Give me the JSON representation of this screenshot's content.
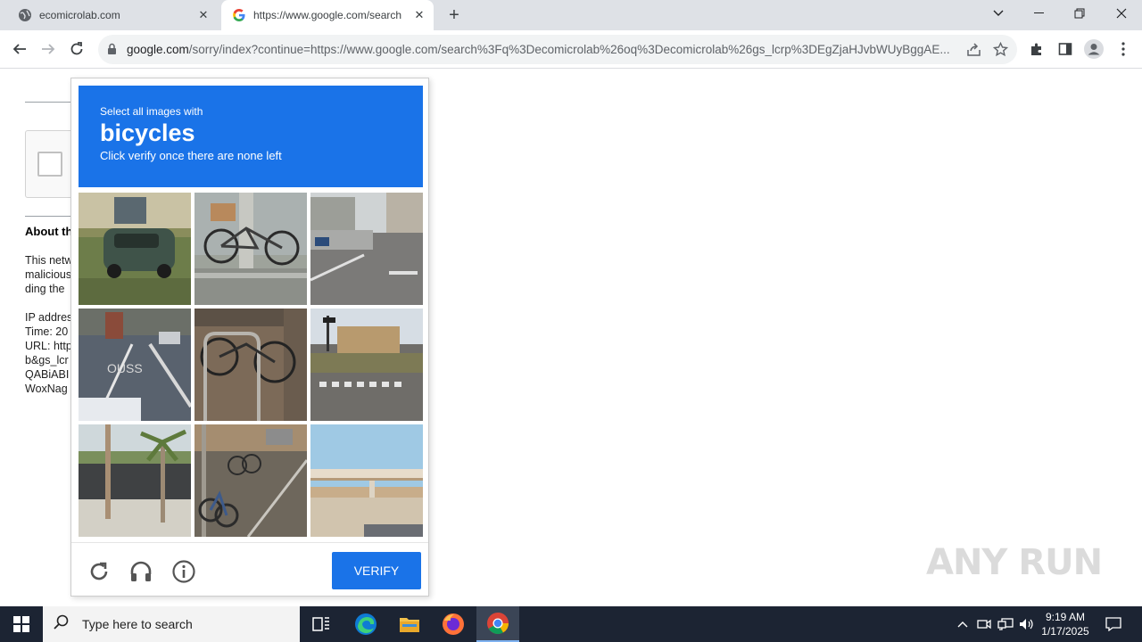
{
  "browser": {
    "tabs": [
      {
        "title": "ecomicrolab.com",
        "active": false
      },
      {
        "title": "https://www.google.com/search",
        "active": true
      }
    ],
    "url_host": "google.com",
    "url_path": "/sorry/index?continue=https://www.google.com/search%3Fq%3Decomicrolab%26oq%3Decomicrolab%26gs_lcrp%3DEgZjaHJvbWUyBggAE..."
  },
  "page": {
    "about_heading": "About th",
    "paragraph_lines": [
      "This netw",
      "malicious",
      "ding the"
    ],
    "info_lines": [
      "IP addres",
      "Time: 20",
      "URL: http",
      "b&gs_lcr",
      "QABiABI",
      "WoxNag"
    ]
  },
  "challenge": {
    "instruction_small": "Select all images with",
    "target_object": "bicycles",
    "instruction_sub": "Click verify once there are none left",
    "verify_label": "VERIFY",
    "tiles": [
      {
        "scene": "car-parked-on-grass"
      },
      {
        "scene": "bicycle-at-pole"
      },
      {
        "scene": "street-intersection"
      },
      {
        "scene": "bike-lane-road"
      },
      {
        "scene": "bicycle-racks"
      },
      {
        "scene": "road-crosswalk"
      },
      {
        "scene": "palm-sidewalk"
      },
      {
        "scene": "bicycles-on-sidewalk"
      },
      {
        "scene": "overpass-bridge"
      }
    ]
  },
  "watermark": "ANY RUN",
  "taskbar": {
    "search_placeholder": "Type here to search",
    "time": "9:19 AM",
    "date": "1/17/2025"
  },
  "colors": {
    "accent": "#1a73e8",
    "taskbar": "#1c2433",
    "tabstrip": "#dee1e6"
  }
}
